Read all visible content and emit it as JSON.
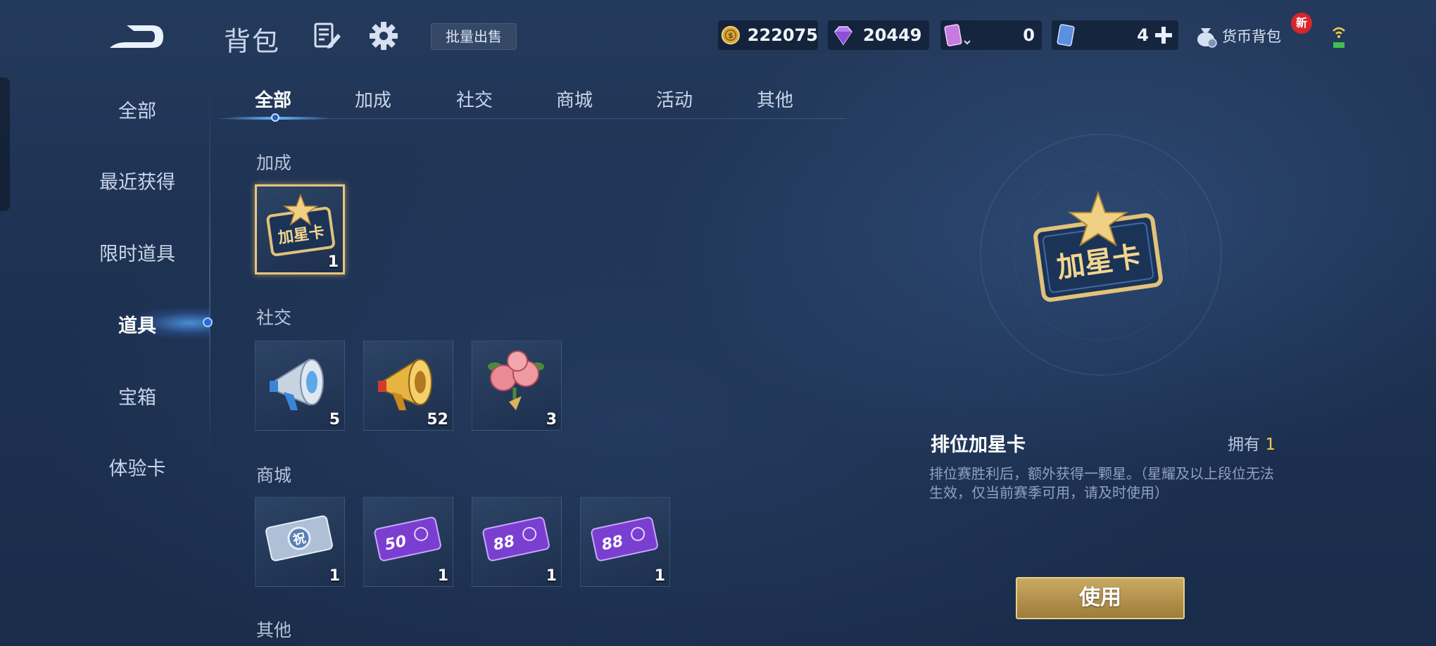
{
  "header": {
    "title": "背包",
    "bulk_sell_label": "批量出售",
    "currencies": {
      "coins": "222075",
      "gems": "20449",
      "card_a": "0",
      "card_b": "4"
    },
    "wallet_label": "货币背包",
    "new_badge": "新"
  },
  "sidebar": {
    "items": [
      {
        "label": "全部"
      },
      {
        "label": "最近获得"
      },
      {
        "label": "限时道具"
      },
      {
        "label": "道具"
      },
      {
        "label": "宝箱"
      },
      {
        "label": "体验卡"
      }
    ],
    "active_index": 3
  },
  "tabs": [
    {
      "label": "全部"
    },
    {
      "label": "加成"
    },
    {
      "label": "社交"
    },
    {
      "label": "商城"
    },
    {
      "label": "活动"
    },
    {
      "label": "其他"
    }
  ],
  "sections": {
    "boost": {
      "label": "加成",
      "items": [
        {
          "icon": "star-card-icon",
          "icon_text": "加星卡",
          "count": "1"
        }
      ]
    },
    "social": {
      "label": "社交",
      "items": [
        {
          "icon": "silver-megaphone-icon",
          "count": "5"
        },
        {
          "icon": "gold-megaphone-icon",
          "count": "52"
        },
        {
          "icon": "rose-bouquet-icon",
          "count": "3"
        }
      ]
    },
    "mall": {
      "label": "商城",
      "items": [
        {
          "icon": "silver-coupon-icon",
          "icon_text": "祝",
          "count": "1"
        },
        {
          "icon": "purple-coupon-50-icon",
          "icon_text": "50",
          "count": "1"
        },
        {
          "icon": "purple-coupon-88-icon",
          "icon_text": "88",
          "count": "1"
        },
        {
          "icon": "purple-coupon-88-icon",
          "icon_text": "88",
          "count": "1"
        }
      ]
    },
    "other": {
      "label": "其他"
    }
  },
  "detail": {
    "icon_text": "加星卡",
    "name": "排位加星卡",
    "owned_label": "拥有",
    "owned_count": "1",
    "description": "排位赛胜利后，额外获得一颗星。（星耀及以上段位无法生效，仅当前赛季可用，请及时使用）",
    "use_button": "使用"
  },
  "colors": {
    "accent_gold": "#e8c57a",
    "active_blue": "#68b7ff",
    "badge_red": "#d7262c"
  }
}
